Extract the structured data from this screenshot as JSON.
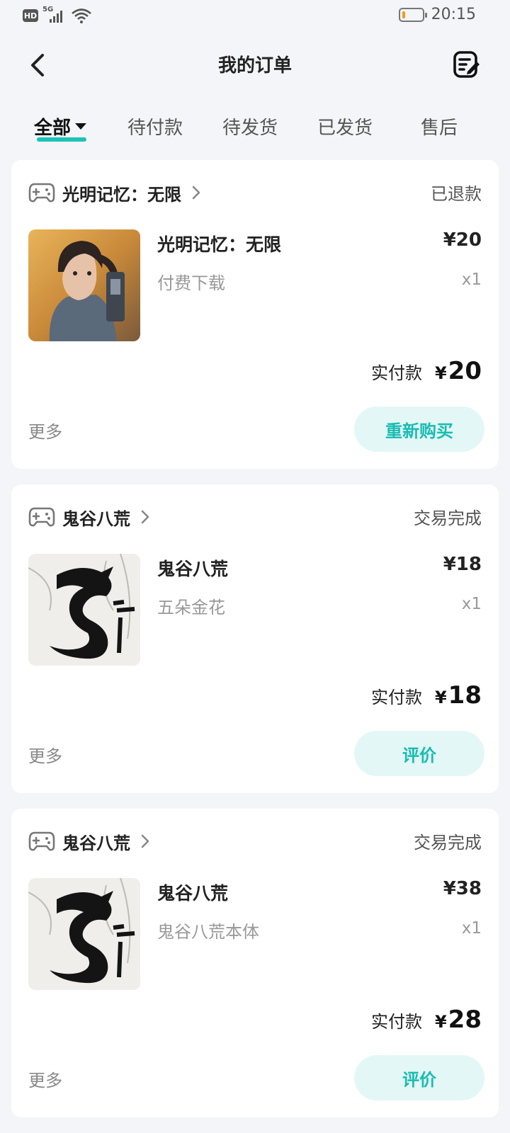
{
  "status_bar": {
    "network_badge": "HD",
    "signal_label": "5G",
    "time": "20:15",
    "battery_level_fraction": 0.15
  },
  "header": {
    "title": "我的订单",
    "back_icon": "back-arrow-icon",
    "edit_icon": "edit-note-icon"
  },
  "tabs": [
    {
      "label": "全部",
      "active": true
    },
    {
      "label": "待付款",
      "active": false
    },
    {
      "label": "待发货",
      "active": false
    },
    {
      "label": "已发货",
      "active": false
    },
    {
      "label": "售后",
      "active": false
    }
  ],
  "orders": [
    {
      "store_name": "光明记忆：无限",
      "status": "已退款",
      "item_title": "光明记忆：无限",
      "item_subtitle": "付费下载",
      "price": "¥20",
      "quantity": "x1",
      "paid_label": "实付款",
      "paid_currency": "¥",
      "paid_amount": "20",
      "more_label": "更多",
      "action_label": "重新购买"
    },
    {
      "store_name": "鬼谷八荒",
      "status": "交易完成",
      "item_title": "鬼谷八荒",
      "item_subtitle": "五朵金花",
      "price": "¥18",
      "quantity": "x1",
      "paid_label": "实付款",
      "paid_currency": "¥",
      "paid_amount": "18",
      "more_label": "更多",
      "action_label": "评价"
    },
    {
      "store_name": "鬼谷八荒",
      "status": "交易完成",
      "item_title": "鬼谷八荒",
      "item_subtitle": "鬼谷八荒本体",
      "price": "¥38",
      "quantity": "x1",
      "paid_label": "实付款",
      "paid_currency": "¥",
      "paid_amount": "28",
      "more_label": "更多",
      "action_label": "评价"
    }
  ],
  "colors": {
    "accent": "#1cc3b8",
    "action_bg": "#e3f7f6",
    "page_bg": "#f3f5f8"
  }
}
